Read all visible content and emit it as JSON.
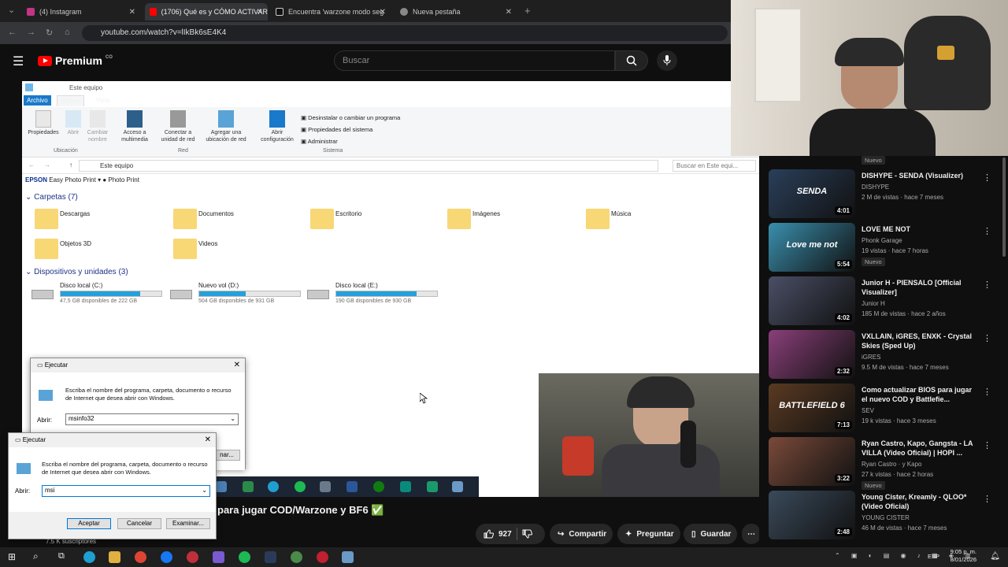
{
  "browser": {
    "tabs": [
      {
        "label": "(4) Instagram",
        "color": "#c13584"
      },
      {
        "label": "(1706) Qué es y CÓMO ACTIVAR",
        "color": "#ff0000"
      },
      {
        "label": "Encuentra 'warzone modo seg",
        "color": "#111111"
      },
      {
        "label": "Nueva pestaña",
        "color": "#888888"
      }
    ],
    "url": "youtube.com/watch?v=lIkBk6sE4K4"
  },
  "youtube": {
    "brand": "Premium",
    "country": "CO",
    "search_placeholder": "Buscar",
    "video_title": "para jugar COD/Warzone y BF6 ✅",
    "likes": "927",
    "share": "Compartir",
    "ask": "Preguntar",
    "save": "Guardar",
    "subscribers": "7.5 K suscriptores"
  },
  "explorer": {
    "title": "Este equipo",
    "tabs": [
      "Archivo",
      "Equipo",
      "Vista"
    ],
    "ribbon": {
      "buttons": [
        "Propiedades",
        "Abrir",
        "Cambiar nombre",
        "Acceso a multimedia",
        "Conectar a unidad de red",
        "Agregar una ubicación de red",
        "Abrir configuración"
      ],
      "system_links": [
        "Desinstalar o cambiar un programa",
        "Propiedades del sistema",
        "Administrar"
      ],
      "groups": [
        "Ubicación",
        "Red",
        "Sistema"
      ]
    },
    "path": "Este equipo",
    "search_placeholder": "Buscar en Este equi...",
    "epson": "EPSON",
    "epson_easy": "Easy Photo Print",
    "photo_print": "Photo Print",
    "folders_header": "Carpetas (7)",
    "folders": [
      "Descargas",
      "Documentos",
      "Escritorio",
      "Imágenes",
      "Música",
      "Objetos 3D",
      "Videos"
    ],
    "devices_header": "Dispositivos y unidades (3)",
    "drives": [
      {
        "name": "Disco local (C:)",
        "free": "47,5 GB disponibles de 222 GB",
        "used_fraction": 0.79
      },
      {
        "name": "Nuevo vol (D:)",
        "free": "504 GB disponibles de 931 GB",
        "used_fraction": 0.46
      },
      {
        "name": "Disco local (E:)",
        "free": "190 GB disponibles de 930 GB",
        "used_fraction": 0.8
      }
    ]
  },
  "run_dialogs": [
    {
      "title": "Ejecutar",
      "desc": "Escriba el nombre del programa, carpeta, documento o recurso de Internet que desea abrir con Windows.",
      "label": "Abrir:",
      "value": "msinfo32",
      "partial_button": "nar..."
    },
    {
      "title": "Ejecutar",
      "desc": "Escriba el nombre del programa, carpeta, documento o recurso de Internet que desea abrir con Windows.",
      "label": "Abrir:",
      "value": "msi",
      "ok": "Aceptar",
      "cancel": "Cancelar",
      "browse": "Examinar..."
    }
  ],
  "sidebar": [
    {
      "badge_top": "Nuevo"
    },
    {
      "title": "DISHYPE - SENDA (Visualizer)",
      "channel": "DISHYPE",
      "meta": "2 M de vistas · hace 7 meses",
      "duration": "4:01",
      "thumb": "#2a3f5a",
      "thumb_text": "SENDA"
    },
    {
      "title": "LOVE ME NOT",
      "channel": "Phonk Garage",
      "meta": "19 vistas · hace 7 horas",
      "badge": "Nuevo",
      "duration": "5:54",
      "thumb": "#3a8fae",
      "thumb_text": "Love me not"
    },
    {
      "title": "Junior H - PIENSALO [Official Visualizer]",
      "channel": "Junior H",
      "meta": "185 M de vistas · hace 2 años",
      "duration": "4:02",
      "thumb": "#4a4f66"
    },
    {
      "title": "VXLLAIN, iGRES, ENXK - Crystal Skies (Sped Up)",
      "channel": "iGRES",
      "meta": "9.5 M de vistas · hace 7 meses",
      "duration": "2:32",
      "thumb": "#8a3f7a"
    },
    {
      "title": "Como actualizar BIOS para jugar el nuevo COD y Battlefie...",
      "channel": "SEV",
      "meta": "19 k vistas · hace 3 meses",
      "duration": "7:13",
      "thumb": "#5a3a22",
      "thumb_text": "BATTLEFIELD 6"
    },
    {
      "title": "Ryan Castro, Kapo, Gangsta - LA VILLA (Video Oficial) | HOPI ...",
      "channel": "Ryan Castro · y Kapo",
      "meta": "27 k vistas · hace 2 horas",
      "badge": "Nuevo",
      "duration": "3:22",
      "thumb": "#7a4a3a"
    },
    {
      "title": "Young Cister, Kreamly - QLOO* (Video Oficial)",
      "channel": "YOUNG CISTER",
      "meta": "46 M de vistas · hace 7 meses",
      "duration": "2:48",
      "thumb": "#3a4a5a"
    }
  ],
  "taskbar": {
    "lang": "ESP",
    "time": "9:05 p. m.",
    "date": "8/01/2026"
  }
}
